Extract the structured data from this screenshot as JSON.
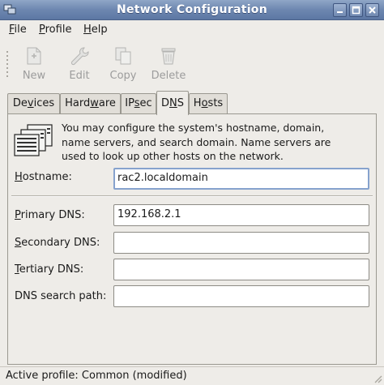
{
  "window": {
    "title": "Network Configuration",
    "icon": "network-icon",
    "buttons": [
      "minimize-icon",
      "maximize-icon",
      "close-icon"
    ]
  },
  "menubar": {
    "items": [
      {
        "label": "File",
        "mnemonic": "F",
        "rest": "ile"
      },
      {
        "label": "Profile",
        "mnemonic": "P",
        "rest": "rofile"
      },
      {
        "label": "Help",
        "mnemonic": "H",
        "rest": "elp"
      }
    ]
  },
  "toolbar": {
    "new_label": "New",
    "edit_label": "Edit",
    "copy_label": "Copy",
    "delete_label": "Delete",
    "state": "disabled"
  },
  "tabs": [
    {
      "label": "Devices",
      "pre": "De",
      "mn": "v",
      "post": "ices"
    },
    {
      "label": "Hardware",
      "pre": "Hard",
      "mn": "w",
      "post": "are"
    },
    {
      "label": "IPsec",
      "pre": "IP",
      "mn": "s",
      "post": "ec"
    },
    {
      "label": "DNS",
      "pre": "D",
      "mn": "N",
      "post": "S",
      "active": true
    },
    {
      "label": "Hosts",
      "pre": "H",
      "mn": "o",
      "post": "sts"
    }
  ],
  "dns": {
    "description": "You may configure the system's hostname, domain, name servers, and search domain. Name servers are used to look up other hosts on the network.",
    "desc_lines": [
      "You may configure the system's hostname, domain,",
      "name servers, and search domain. Name servers are",
      "used to look up other hosts on the network."
    ],
    "hostname": {
      "label_mn": "H",
      "label_rest": "ostname:",
      "value": "rac2.localdomain"
    },
    "primary_dns": {
      "label_mn": "P",
      "label_rest": "rimary DNS:",
      "value": "192.168.2.1"
    },
    "secondary_dns": {
      "label_mn": "S",
      "label_rest": "econdary DNS:",
      "value": ""
    },
    "tertiary_dns": {
      "label_mn": "T",
      "label_rest": "ertiary DNS:",
      "value": ""
    },
    "search_path": {
      "label": "DNS search path:",
      "value": ""
    }
  },
  "status": {
    "text": "Active profile: Common (modified)"
  }
}
